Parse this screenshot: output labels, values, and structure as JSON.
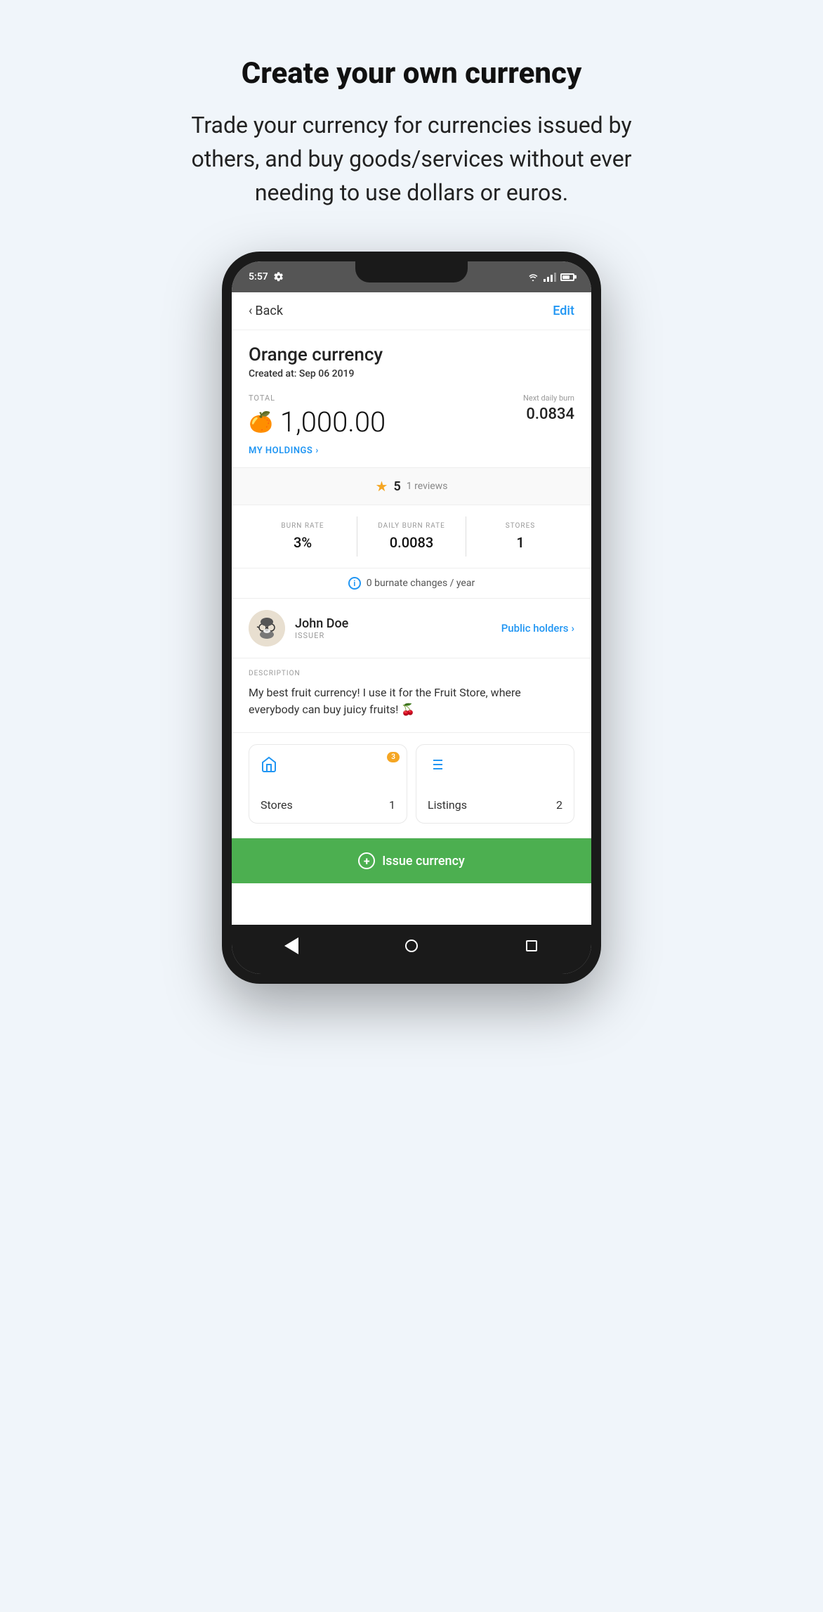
{
  "page": {
    "headline": "Create your own currency",
    "subheadline": "Trade your currency for currencies issued by others, and buy goods/services without ever needing to use dollars or euros."
  },
  "status_bar": {
    "time": "5:57",
    "wifi": true,
    "signal": true,
    "battery": true
  },
  "nav": {
    "back_label": "Back",
    "edit_label": "Edit"
  },
  "currency": {
    "name": "Orange currency",
    "created_label": "Created at:",
    "created_date": "Sep 06 2019",
    "total_label": "TOTAL",
    "total_amount": "1,000.00",
    "next_burn_label": "Next daily burn",
    "next_burn_value": "0.0834",
    "my_holdings_label": "MY HOLDINGS",
    "emoji": "🍊"
  },
  "rating": {
    "star": "★",
    "value": "5",
    "reviews": "1 reviews"
  },
  "stats": {
    "burn_rate_label": "BURN RATE",
    "burn_rate_value": "3%",
    "daily_burn_label": "DAILY BURN RATE",
    "daily_burn_value": "0.0083",
    "stores_label": "STORES",
    "stores_value": "1",
    "burnate_info": "0 burnate changes / year"
  },
  "issuer": {
    "name": "John Doe",
    "role": "ISSUER",
    "public_holders_label": "Public holders"
  },
  "description": {
    "label": "DESCRIPTION",
    "text": "My best fruit currency! I use it for the Fruit Store, where everybody can buy juicy fruits! 🍒"
  },
  "cards": [
    {
      "label": "Stores",
      "value": "1",
      "badge": "3",
      "icon": "house"
    },
    {
      "label": "Listings",
      "value": "2",
      "badge": null,
      "icon": "list"
    }
  ],
  "issue_button": {
    "label": "Issue currency"
  },
  "bottom_nav": {
    "back_icon": "triangle-left",
    "home_icon": "circle",
    "recent_icon": "square"
  }
}
